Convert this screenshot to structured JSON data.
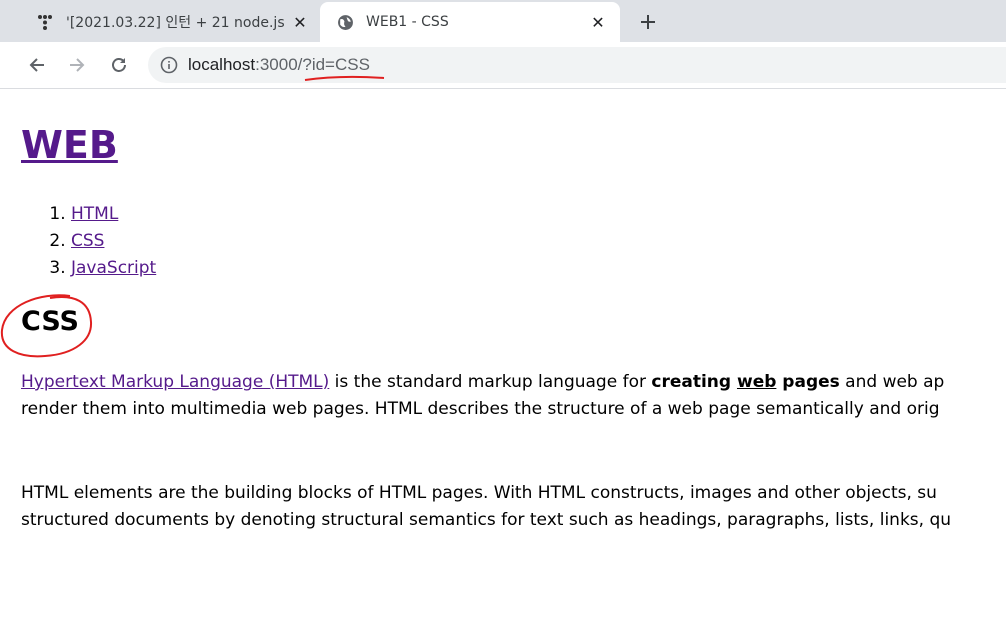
{
  "browser": {
    "tabs": [
      {
        "title": "'[2021.03.22] 인턴 + 21 node.js",
        "icon": "tistory-icon"
      },
      {
        "title": "WEB1 - CSS",
        "icon": "globe-icon"
      }
    ],
    "url_host": "localhost",
    "url_rest": ":3000/?id=CSS",
    "annotation_color": "#e02020"
  },
  "page": {
    "heading": "WEB",
    "nav": [
      "HTML",
      "CSS",
      "JavaScript"
    ],
    "topic": "CSS",
    "para1": {
      "link": "Hypertext Markup Language (HTML)",
      "t1": " is the standard markup language for ",
      "b1": "creating ",
      "b2": "web",
      "b3": " pages",
      "t2": " and web ap",
      "line2": "render them into multimedia web pages. HTML describes the structure of a web page semantically and orig"
    },
    "para2": {
      "line1": "HTML elements are the building blocks of HTML pages. With HTML constructs, images and other objects, su",
      "line2": "structured documents by denoting structural semantics for text such as headings, paragraphs, lists, links, qu"
    }
  }
}
